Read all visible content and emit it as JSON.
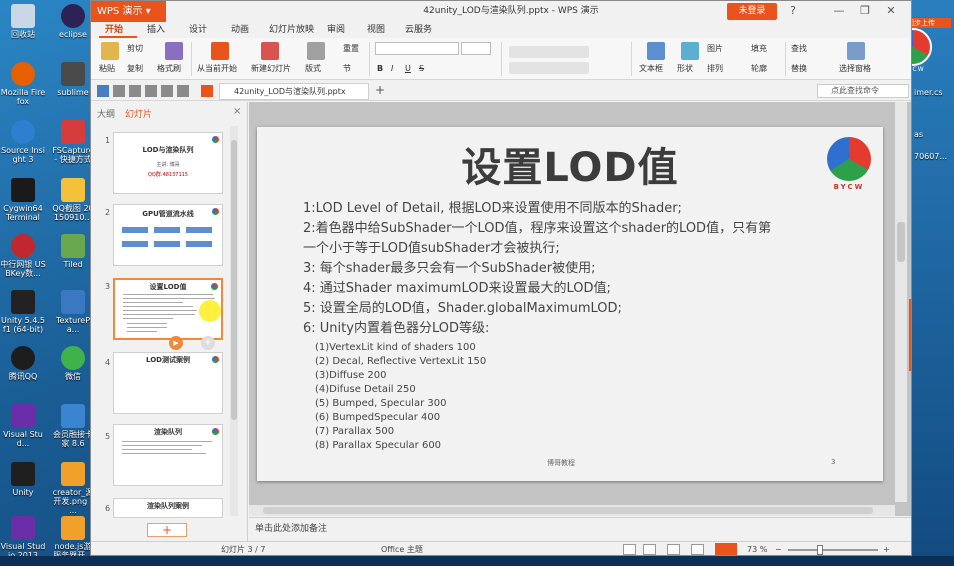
{
  "desktop": {
    "icons": [
      {
        "label": "回收站",
        "color": "#c9d7e6"
      },
      {
        "label": "eclipse",
        "color": "#2c2255"
      },
      {
        "label": "Mozilla Firefox",
        "color": "#e66000"
      },
      {
        "label": "sublime",
        "color": "#4a4a4a"
      },
      {
        "label": "Source Insight 3",
        "color": "#2d7fd0"
      },
      {
        "label": "FSCapture - 快捷方式",
        "color": "#d63c3c"
      },
      {
        "label": "Cygwin64 Terminal",
        "color": "#1a1a1a"
      },
      {
        "label": "QQ截图 20150910...",
        "color": "#f3c13a"
      },
      {
        "label": "中行网银 USBKey数...",
        "color": "#c0282e"
      },
      {
        "label": "Tiled",
        "color": "#6aa84f"
      },
      {
        "label": "Unity 5.4.5f1 (64-bit)",
        "color": "#222222"
      },
      {
        "label": "TexturePa...",
        "color": "#3b78c2"
      },
      {
        "label": "腾讯QQ",
        "color": "#1d1d1d"
      },
      {
        "label": "微信",
        "color": "#3fb24a"
      },
      {
        "label": "Visual Stud...",
        "color": "#6a2fa8"
      },
      {
        "label": "会员融接卡 家 8.6",
        "color": "#3a84d0"
      },
      {
        "label": "Unity",
        "color": "#1f1f1f"
      },
      {
        "label": "creator_源 开发.png - ...",
        "color": "#f1a02a"
      },
      {
        "label": "Visual Studio 2013",
        "color": "#6a2fa8"
      },
      {
        "label": "node.js游 服务器开...",
        "color": "#f1a02a"
      }
    ]
  },
  "window": {
    "app_name": "WPS 演示",
    "doc_title": "42unity_LOD与渲染队列.pptx - WPS 演示",
    "login_label": "未登录",
    "controls": [
      "?",
      "—",
      "❐",
      "✕"
    ]
  },
  "ribbon_tabs": [
    "开始",
    "插入",
    "设计",
    "动画",
    "幻灯片放映",
    "审阅",
    "视图",
    "云服务"
  ],
  "ribbon": {
    "paste": "粘贴",
    "cut": "剪切",
    "copy": "复制",
    "format_painter": "格式刷",
    "from_current": "从当前开始",
    "new_slide": "新建幻灯片",
    "layout": "版式",
    "section": "节",
    "reset": "重置",
    "textbox": "文本框",
    "shape": "形状",
    "arrange": "排列",
    "picture": "图片",
    "fill": "填充",
    "outline": "轮廓",
    "find": "查找",
    "replace": "替换",
    "select_pane": "选择窗格",
    "bold": "B",
    "italic": "I",
    "underline": "U",
    "strike": "S"
  },
  "qa": {
    "doc_tab": "42unity_LOD与渲染队列.pptx",
    "add_tab": "+",
    "search_placeholder": "点此查找命令"
  },
  "panel": {
    "tab_outline": "大纲",
    "tab_slides": "幻灯片",
    "close": "×",
    "add_slide": "+",
    "thumbnails": [
      {
        "num": "1",
        "title": "LOD与渲染队列",
        "red": "QQ群:48137115",
        "sub": "主讲: 博哥"
      },
      {
        "num": "2",
        "title": "GPU管道流水线"
      },
      {
        "num": "3",
        "title": "设置LOD值"
      },
      {
        "num": "4",
        "title": "LOD测试案例"
      },
      {
        "num": "5",
        "title": "渲染队列"
      },
      {
        "num": "6",
        "title": "渲染队列案例"
      }
    ]
  },
  "slide": {
    "title": "设置LOD值",
    "logo_text": "BYCW",
    "bullets": [
      "1:LOD Level of Detail, 根据LOD来设置使用不同版本的Shader;",
      "2:着色器中给SubShader一个LOD值，程序来设置这个shader的LOD值，只有第",
      "一个小于等于LOD值subShader才会被执行;",
      "3: 每个shader最多只会有一个SubShader被使用;",
      "4: 通过Shader maximumLOD来设置最大的LOD值;",
      "5: 设置全局的LOD值，Shader.globalMaximumLOD;",
      "6: Unity内置着色器分LOD等级:"
    ],
    "levels": [
      "(1)VertexLit kind of shaders 100",
      "(2) Decal, Reflective VertexLit 150",
      "(3)Diffuse 200",
      "(4)Difuse Detail  250",
      "(5) Bumped, Specular   300",
      "(6) BumpedSpecular  400",
      "(7) Parallax  500",
      "(8) Parallax Specular 600"
    ],
    "footer": "博哥教程",
    "page_number": "3"
  },
  "notes_placeholder": "单击此处添加备注",
  "status": {
    "slide_count": "幻灯片 3 / 7",
    "theme": "Office 主题",
    "zoom": "73 %",
    "zoom_minus": "−",
    "zoom_plus": "+"
  },
  "right_peek": {
    "badge": "同步上传",
    "logo_text": "BYCW",
    "texts": [
      "imer.cs",
      "as",
      "70607..."
    ]
  }
}
